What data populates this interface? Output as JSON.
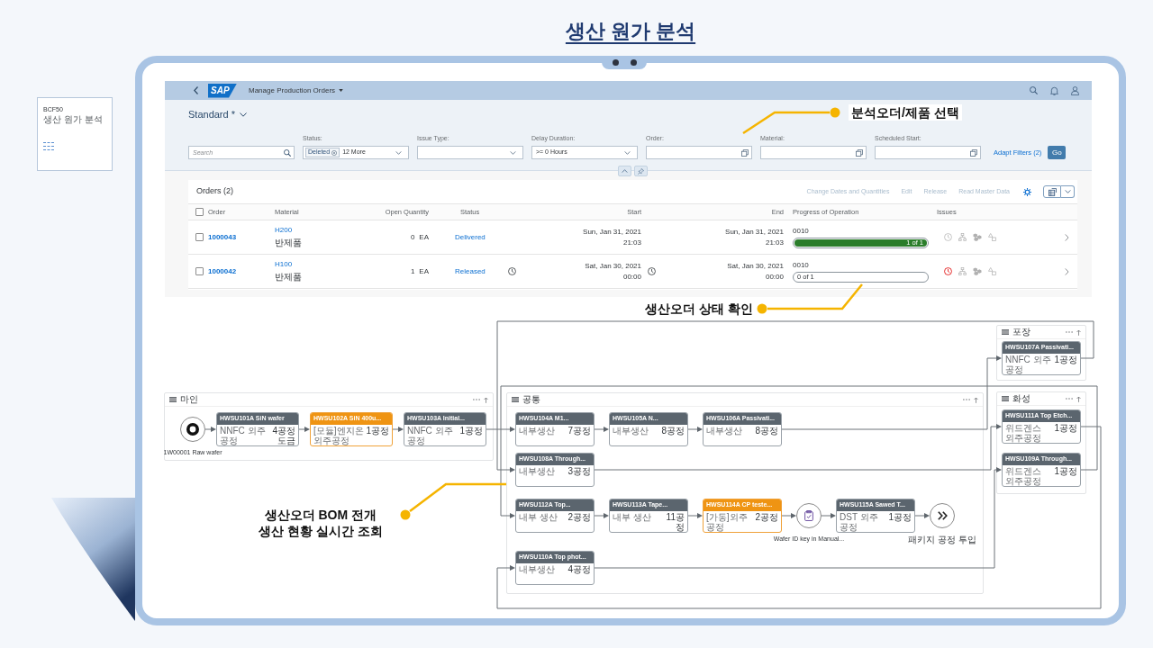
{
  "title": "생산 원가 분석",
  "tile": {
    "code": "BCF50",
    "name": "생산 원가 분석"
  },
  "app": {
    "logo": "SAP",
    "app_title": "Manage Production Orders",
    "variant": "Standard *",
    "filters": [
      {
        "kind": "search",
        "placeholder": "Search"
      },
      {
        "kind": "tokens",
        "label": "Status:",
        "token": "Deleted",
        "more": "12 More"
      },
      {
        "kind": "select",
        "label": "Issue Type:"
      },
      {
        "kind": "select",
        "label": "Delay Duration:",
        "value": ">= 0 Hours"
      },
      {
        "kind": "valuehelp",
        "label": "Order:"
      },
      {
        "kind": "valuehelp",
        "label": "Material:"
      },
      {
        "kind": "valuehelp",
        "label": "Scheduled Start:"
      }
    ],
    "adapt_filters": "Adapt Filters (2)",
    "go": "Go",
    "orders": {
      "title": "Orders (2)",
      "actions": [
        {
          "label": "Change Dates and Quantities",
          "disabled": true
        },
        {
          "label": "Edit",
          "disabled": true
        },
        {
          "label": "Release",
          "disabled": true
        },
        {
          "label": "Read Master Data",
          "disabled": true
        }
      ],
      "all_selected": false,
      "columns": [
        "Order",
        "Material",
        "Open Quantity",
        "Status",
        "Start",
        "End",
        "Progress of Operation",
        "Issues"
      ],
      "rows": [
        {
          "selected": false,
          "order": "1000043",
          "material": "H200",
          "material_type": "반제품",
          "quantity": "0",
          "unit": "EA",
          "status": "Delivered",
          "start_warning": false,
          "start_date": "Sun, Jan 31, 2021",
          "start_time": "21:03",
          "end_warning": false,
          "end_date": "Sun, Jan 31, 2021",
          "end_time": "21:03",
          "operation": "0010",
          "level": 1,
          "progress": "1 of 1",
          "delay_issue": false
        },
        {
          "selected": false,
          "order": "1000042",
          "material": "H100",
          "material_type": "반제품",
          "quantity": "1",
          "unit": "EA",
          "status": "Released",
          "start_warning": true,
          "start_date": "Sat, Jan 30, 2021",
          "start_time": "00:00",
          "end_warning": true,
          "end_date": "Sat, Jan 30, 2021",
          "end_time": "00:00",
          "operation": "0010",
          "level": 0,
          "progress": "0 of 1",
          "delay_issue": true
        }
      ]
    }
  },
  "diagram": {
    "groups": [
      {
        "title": "마인",
        "nodes": [
          {
            "kind": "start",
            "label": "1W00001 Raw wafer"
          },
          {
            "kind": "operation",
            "title": "HWSU101A SiN wafer",
            "detail": "NNFC 외주 공정",
            "step": "4공정 도금",
            "highlighted": false
          },
          {
            "kind": "operation",
            "title": "HWSU102A SiN 400u...",
            "detail": "[모듈]엔지온 외주공정",
            "step": "1공정",
            "highlighted": true
          },
          {
            "kind": "operation",
            "title": "HWSU103A Initial...",
            "detail": "NNFC 외주 공정",
            "step": "1공정",
            "highlighted": false
          }
        ]
      },
      {
        "title": "공통",
        "nodes": [
          {
            "kind": "operation",
            "title": "HWSU104A M1...",
            "detail": "내부생산",
            "step": "7공정",
            "highlighted": false
          },
          {
            "kind": "operation",
            "title": "HWSU105A N...",
            "detail": "내부생산",
            "step": "8공정",
            "highlighted": false
          },
          {
            "kind": "operation",
            "title": "HWSU106A Passivati...",
            "detail": "내부생산",
            "step": "8공정",
            "highlighted": false
          },
          {
            "kind": "operation",
            "title": "HWSU108A Through...",
            "detail": "내부생산",
            "step": "3공정",
            "highlighted": false
          },
          {
            "kind": "operation",
            "title": "HWSU112A Top...",
            "detail": "내부 생산",
            "step": "2공정",
            "highlighted": false
          },
          {
            "kind": "operation",
            "title": "HWSU113A Tape...",
            "detail": "내부 생산",
            "step": "11공정",
            "highlighted": false
          },
          {
            "kind": "operation",
            "title": "HWSU114A CP teste...",
            "detail": "[가동]외주 공정",
            "step": "2공정",
            "highlighted": true
          },
          {
            "kind": "manual",
            "label": "Wafer ID key in Manual..."
          },
          {
            "kind": "operation",
            "title": "HWSU115A Sawed T...",
            "detail": "DST 외주공정",
            "step": "1공정",
            "highlighted": false
          },
          {
            "kind": "next",
            "label": "패키지 공정 투입"
          },
          {
            "kind": "operation",
            "title": "HWSU110A Top phot...",
            "detail": "내부생산",
            "step": "4공정",
            "highlighted": false
          }
        ]
      },
      {
        "title": "포장",
        "nodes": [
          {
            "kind": "operation",
            "title": "HWSU107A Passivati...",
            "detail": "NNFC 외주 공정",
            "step": "1공정",
            "highlighted": false
          }
        ]
      },
      {
        "title": "화성",
        "nodes": [
          {
            "kind": "operation",
            "title": "HWSU111A Top Etch...",
            "detail": "위드겐스 외주공정",
            "step": "1공정",
            "highlighted": false
          },
          {
            "kind": "operation",
            "title": "HWSU109A Through...",
            "detail": "위드겐스 외주공정",
            "step": "1공정",
            "highlighted": false
          }
        ]
      }
    ]
  },
  "annotations": [
    {
      "lines": [
        "분석오더/제품 선택"
      ]
    },
    {
      "lines": [
        "생산오더 상태 확인"
      ]
    },
    {
      "lines": [
        "생산오더 BOM 전개",
        "생산 현황 실시간 조회"
      ]
    }
  ]
}
